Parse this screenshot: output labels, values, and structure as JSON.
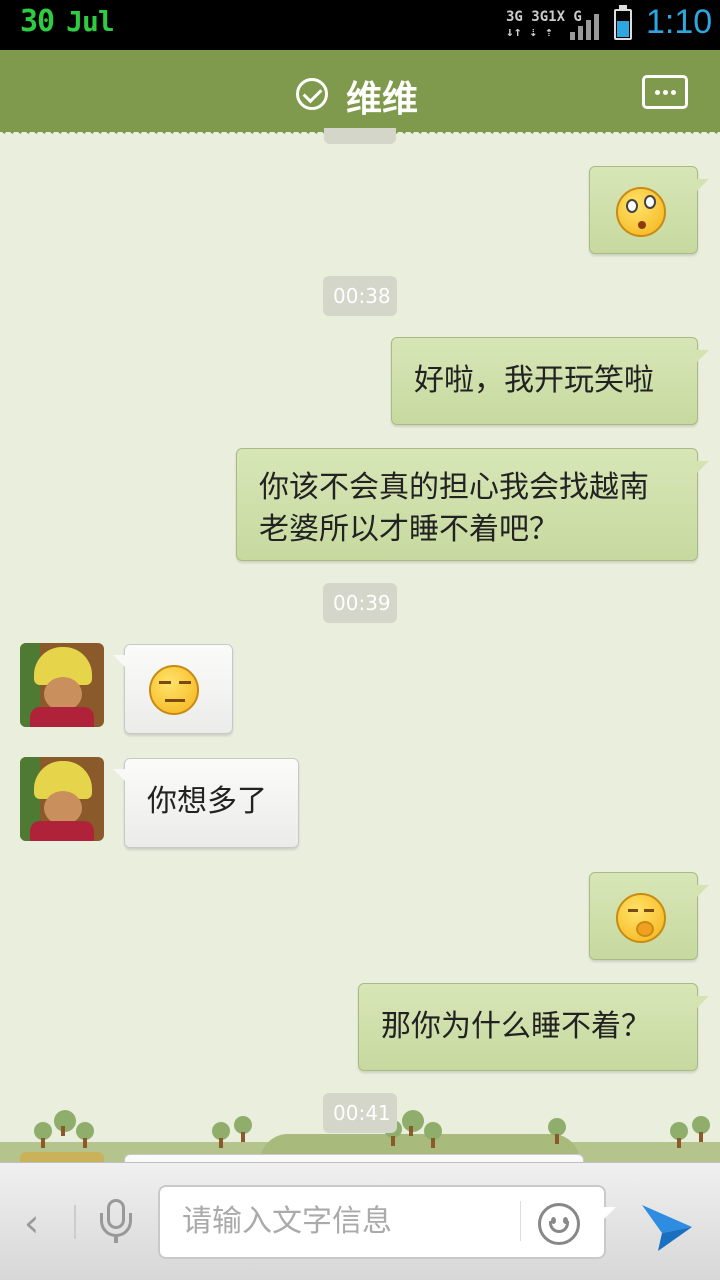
{
  "status_bar": {
    "day": "30",
    "month": "Jul",
    "network_line1": "3G 3G1X G",
    "network_line2": "↓↑ ⇣ ⇡",
    "time": "1:10"
  },
  "header": {
    "title": "维维"
  },
  "messages": [
    {
      "type": "emoji",
      "side": "out",
      "emoji": "dizzy-emoji"
    },
    {
      "type": "time",
      "text": "00:38"
    },
    {
      "type": "text",
      "side": "out",
      "text": "好啦，我开玩笑啦"
    },
    {
      "type": "text",
      "side": "out",
      "text": "你该不会真的担心我会找越南老婆所以才睡不着吧？"
    },
    {
      "type": "time",
      "text": "00:39"
    },
    {
      "type": "emoji",
      "side": "in",
      "emoji": "smug-emoji"
    },
    {
      "type": "text",
      "side": "in",
      "text": "你想多了"
    },
    {
      "type": "emoji",
      "side": "out",
      "emoji": "snicker-emoji"
    },
    {
      "type": "text",
      "side": "out",
      "text": "那你为什么睡不着？"
    },
    {
      "type": "time",
      "text": "00:41"
    }
  ],
  "input": {
    "placeholder": "请输入文字信息"
  },
  "colors": {
    "header_bg": "#7f9a4c",
    "out_bubble": "#c7d99f",
    "in_bubble": "#f5f5f4",
    "chat_bg": "#eaeedd",
    "time_accent": "#2ea7e0",
    "date_accent": "#2ecc40",
    "send_icon": "#2e8de0"
  }
}
